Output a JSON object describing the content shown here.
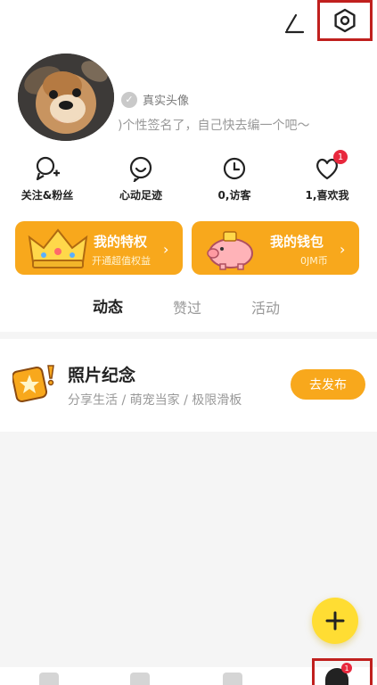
{
  "profile": {
    "verified_label": "真实头像",
    "signature": ")个性签名了，自己快去编一个吧～"
  },
  "stats": [
    {
      "label": "关注&粉丝",
      "icon": "follow-icon"
    },
    {
      "label": "心动足迹",
      "icon": "heart-face-icon"
    },
    {
      "label": "0,访客",
      "icon": "clock-icon"
    },
    {
      "label": "1,喜欢我",
      "icon": "heart-icon",
      "badge": "1"
    }
  ],
  "cards": {
    "privilege": {
      "title": "我的特权",
      "subtitle": "开通超值权益"
    },
    "wallet": {
      "title": "我的钱包",
      "subtitle": "0JM币"
    }
  },
  "tabs": [
    {
      "label": "动态",
      "active": true
    },
    {
      "label": "赞过",
      "active": false
    },
    {
      "label": "活动",
      "active": false
    }
  ],
  "memorial": {
    "title": "照片纪念",
    "subtitle": "分享生活 / 萌宠当家 / 极限滑板",
    "button": "去发布"
  },
  "nav": {
    "profile_badge": "1"
  },
  "colors": {
    "accent": "#f8a81c",
    "fab": "#ffdd33",
    "highlight_box": "#c0201e",
    "badge": "#e8283d"
  }
}
